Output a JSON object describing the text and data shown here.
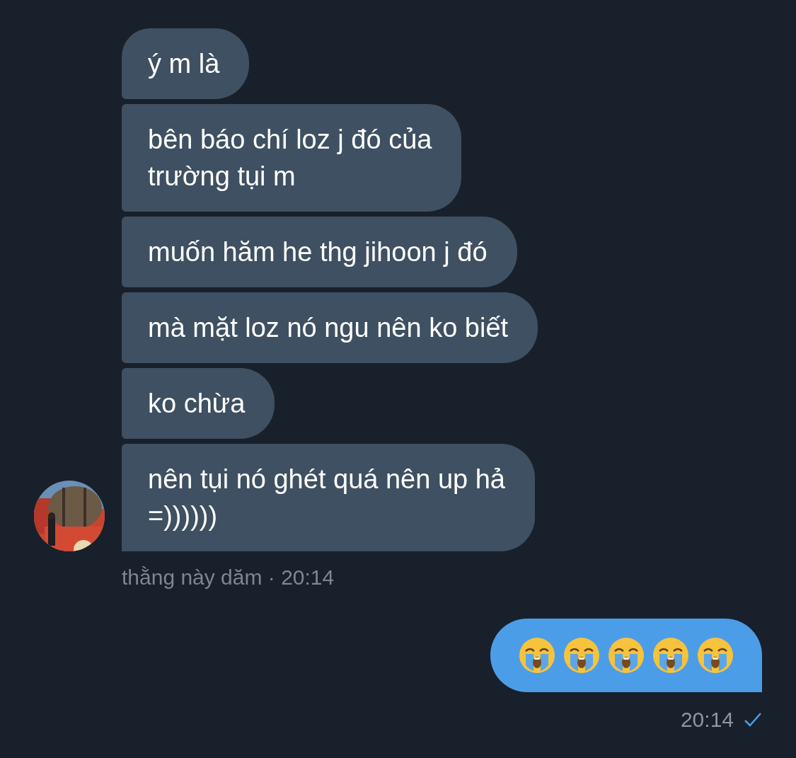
{
  "incoming": {
    "messages": [
      {
        "lines": [
          "ý m là"
        ]
      },
      {
        "lines": [
          "bên báo chí loz j đó của",
          "trường tụi m"
        ]
      },
      {
        "lines": [
          "muốn hăm he thg jihoon j đó"
        ]
      },
      {
        "lines": [
          "mà mặt loz nó ngu nên ko biết"
        ]
      },
      {
        "lines": [
          "ko chừa"
        ]
      },
      {
        "lines": [
          "nên tụi nó ghét quá nên up hả",
          "=))))))"
        ]
      }
    ],
    "caption": "thằng này dăm · 20:14"
  },
  "outgoing": {
    "emoji": [
      {
        "kind": "crying-face"
      },
      {
        "kind": "crying-face"
      },
      {
        "kind": "crying-face"
      },
      {
        "kind": "crying-face"
      },
      {
        "kind": "crying-face"
      }
    ],
    "time": "20:14",
    "read": true
  }
}
